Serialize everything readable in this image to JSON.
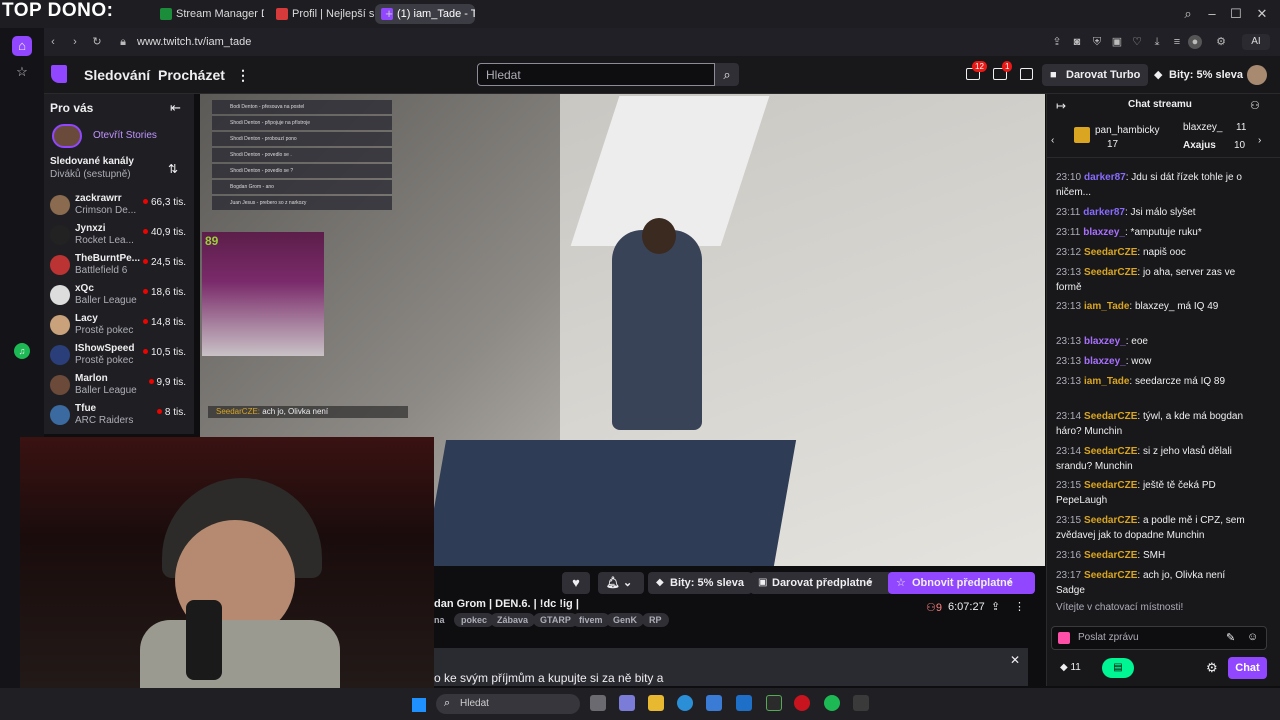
{
  "overlay": {
    "title": "TOP DONO:"
  },
  "browser": {
    "tabs": [
      {
        "label": "Stream Manager Dashboard",
        "active": false,
        "color": "#1b8c3a"
      },
      {
        "label": "Profil | Nejlepší software p",
        "active": false,
        "color": "#d63a3a"
      },
      {
        "label": "(1) iam_Tade - Twitch",
        "active": true,
        "color": "#9147ff"
      }
    ],
    "new_tab": "+",
    "url": "www.twitch.tv/iam_tade",
    "ai_label": "AI"
  },
  "twitch": {
    "nav": {
      "following": "Sledování",
      "browse": "Procházet",
      "more": "⋮",
      "search_placeholder": "Hledat",
      "inbox_badge": "12",
      "whispers_badge": "1",
      "turbo": "Darovat Turbo",
      "bits": "Bity: 5% sleva"
    },
    "sidebar": {
      "for_you": "Pro vás",
      "stories": "Otevřít Stories",
      "followed": "Sledované kanály",
      "sort": "Diváků (sestupně)",
      "channels": [
        {
          "name": "zackrawrr",
          "game": "Crimson De...",
          "viewers": "66,3 tis.",
          "color": "#8a6b4f"
        },
        {
          "name": "Jynxzi",
          "game": "Rocket Lea...",
          "viewers": "40,9 tis.",
          "color": "#222"
        },
        {
          "name": "TheBurntPe...",
          "game": "Battlefield 6",
          "viewers": "24,5 tis.",
          "color": "#b33"
        },
        {
          "name": "xQc",
          "game": "Baller League",
          "viewers": "18,6 tis.",
          "color": "#ddd"
        },
        {
          "name": "Lacy",
          "game": "Prostě pokec",
          "viewers": "14,8 tis.",
          "color": "#c9a27c"
        },
        {
          "name": "IShowSpeed",
          "game": "Prostě pokec",
          "viewers": "10,5 tis.",
          "color": "#2a3e7a"
        },
        {
          "name": "Marlon",
          "game": "Baller League",
          "viewers": "9,9 tis.",
          "color": "#6b4a3a"
        },
        {
          "name": "Tfue",
          "game": "ARC Raiders",
          "viewers": "8 tis.",
          "color": "#3a6aa0"
        }
      ]
    },
    "stream": {
      "title": "dan Grom | DEN.6. | !dc !ig |",
      "tags": [
        "na",
        "pokec",
        "Zábava",
        "GTARP",
        "fivem",
        "GenK",
        "RP"
      ],
      "viewers": "9",
      "uptime": "6:07:27",
      "bits_btn": "Bity: 5% sleva",
      "gift_btn": "Darovat předplatné",
      "renew_btn": "Obnovit předplatné",
      "promo": "o ke svým příjmům a kupujte si za ně bity a",
      "cam_caption_user": "SeedarCZE:",
      "cam_caption_text": "ach jo, Olivka není",
      "cam_counter": "89",
      "mini_chat": [
        "Bodi Denton - přesouva na postel",
        "Shodi Denton - připojuje na přístroje",
        "Shodi Denton - probouzí pono",
        "Shodi Denton - povedlo se .",
        "Shodi Denton - povedlo se ?",
        "Bogdan Grom - ano",
        "Juan Jesus - prebero so z narkozy"
      ]
    },
    "chat": {
      "header": "Chat streamu",
      "leader1_name": "pan_hambicky",
      "leader1_value": "17",
      "leader2_name": "blaxzey_",
      "leader2_value": "11",
      "leader3_name": "Axajus",
      "leader3_value": "10",
      "messages": [
        {
          "time": "23:10",
          "user": "darker87",
          "color": "#8a6bff",
          "text": ": Jdu si dát řízek tohle je o ničem..."
        },
        {
          "time": "23:11",
          "user": "darker87",
          "color": "#8a6bff",
          "text": ": Jsi málo slyšet"
        },
        {
          "time": "23:11",
          "user": "blaxzey_",
          "color": "#a970ff",
          "text": ": *amputuje ruku*"
        },
        {
          "time": "23:12",
          "user": "SeedarCZE",
          "color": "#daa520",
          "text": ": napiš ooc"
        },
        {
          "time": "23:13",
          "user": "SeedarCZE",
          "color": "#daa520",
          "text": ": jo aha, server zas ve formě"
        },
        {
          "time": "23:13",
          "user": "iam_Tade",
          "color": "#daa520",
          "text": ": blaxzey_ má IQ 49"
        },
        {
          "time": "23:13",
          "user": "blaxzey_",
          "color": "#a970ff",
          "text": ": eoe"
        },
        {
          "time": "23:13",
          "user": "blaxzey_",
          "color": "#a970ff",
          "text": ": wow"
        },
        {
          "time": "23:13",
          "user": "iam_Tade",
          "color": "#daa520",
          "text": ": seedarcze má IQ 89"
        },
        {
          "time": "23:14",
          "user": "SeedarCZE",
          "color": "#daa520",
          "text": ": týwl, a kde má bogdan háro? Munchin"
        },
        {
          "time": "23:14",
          "user": "SeedarCZE",
          "color": "#daa520",
          "text": ": si z jeho vlasů dělali srandu? Munchin"
        },
        {
          "time": "23:15",
          "user": "SeedarCZE",
          "color": "#daa520",
          "text": ": ještě tě čeká PD PepeLaugh"
        },
        {
          "time": "23:15",
          "user": "SeedarCZE",
          "color": "#daa520",
          "text": ": a podle mě i CPZ, sem zvědavej jak to dopadne Munchin"
        },
        {
          "time": "23:16",
          "user": "SeedarCZE",
          "color": "#daa520",
          "text": ": SMH"
        },
        {
          "time": "23:17",
          "user": "SeedarCZE",
          "color": "#daa520",
          "text": ": ach jo, Olivka není Sadge"
        }
      ],
      "welcome": "Vítejte v chatovací místnosti!",
      "input_placeholder": "Poslat zprávu",
      "points": "11",
      "send": "Chat"
    }
  },
  "taskbar": {
    "search_placeholder": "Hledat"
  }
}
